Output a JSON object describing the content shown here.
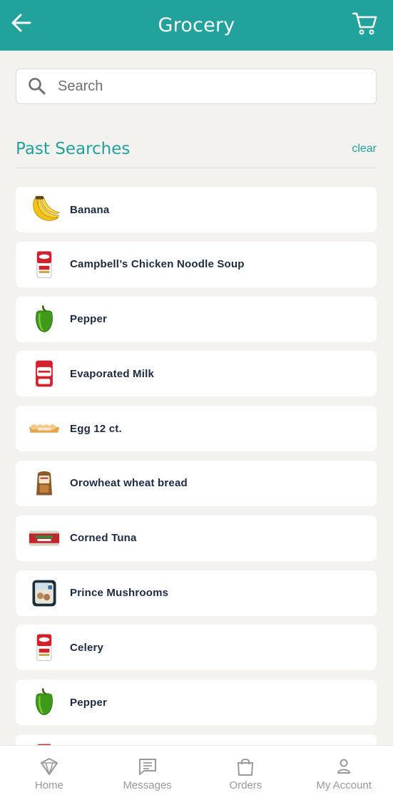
{
  "header": {
    "title": "Grocery",
    "back_icon": "arrow-left-icon",
    "cart_icon": "shopping-cart-icon",
    "background": "#21a29d"
  },
  "search": {
    "placeholder": "Search",
    "value": "",
    "icon": "search-icon"
  },
  "past_searches": {
    "title": "Past Searches",
    "clear_label": "clear",
    "items": [
      {
        "label": "Banana",
        "icon": "banana-icon"
      },
      {
        "label": "Campbell’s Chicken Noodle Soup",
        "icon": "soup-can-icon"
      },
      {
        "label": "Pepper",
        "icon": "pepper-icon"
      },
      {
        "label": "Evaporated Milk",
        "icon": "milk-can-icon"
      },
      {
        "label": "Egg 12 ct.",
        "icon": "egg-carton-icon"
      },
      {
        "label": "Orowheat wheat bread",
        "icon": "bread-icon"
      },
      {
        "label": "Corned Tuna",
        "icon": "tuna-can-icon"
      },
      {
        "label": "Prince Mushrooms",
        "icon": "mushroom-pack-icon"
      },
      {
        "label": "Celery",
        "icon": "soup-can-icon"
      },
      {
        "label": "Pepper",
        "icon": "pepper-icon"
      }
    ]
  },
  "bottom_nav": [
    {
      "label": "Home",
      "icon": "home-icon"
    },
    {
      "label": "Messages",
      "icon": "message-icon"
    },
    {
      "label": "Orders",
      "icon": "shopping-bag-icon"
    },
    {
      "label": "My Account",
      "icon": "person-icon"
    }
  ],
  "colors": {
    "accent": "#21a29d",
    "background": "#f3f2ef",
    "item_text": "#1d2a44",
    "nav_text": "#9a9a9a"
  }
}
